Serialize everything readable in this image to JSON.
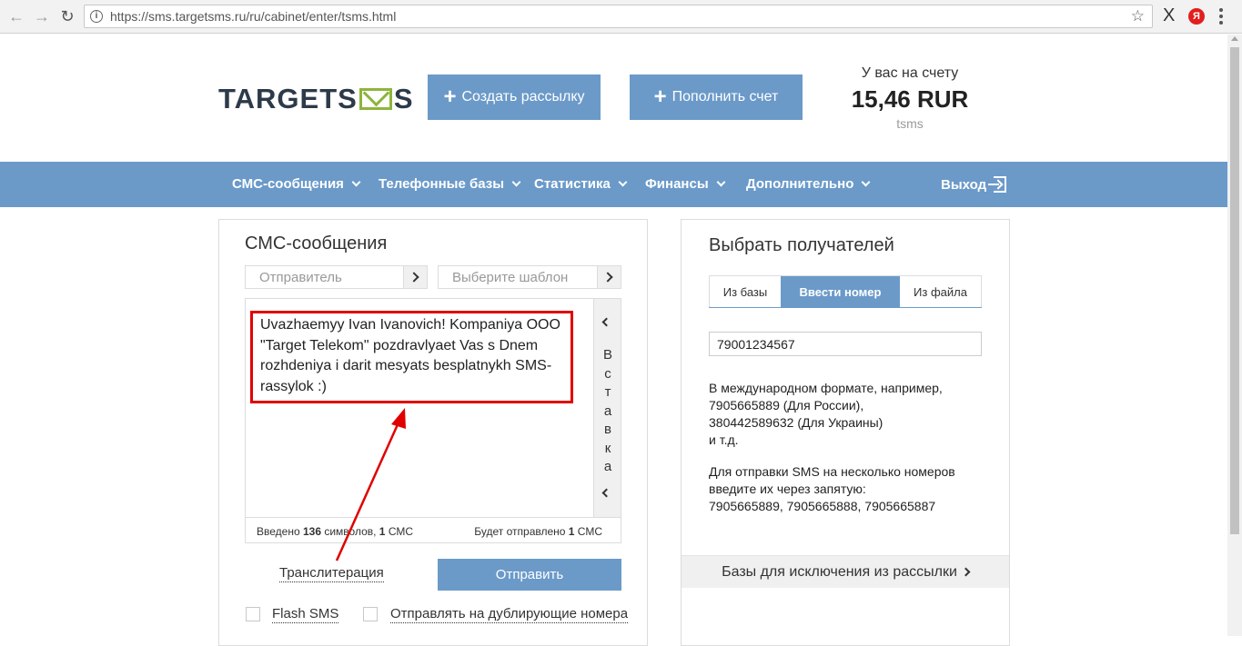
{
  "browser": {
    "url": "https://sms.targetsms.ru/ru/cabinet/enter/tsms.html",
    "extension_x": "X",
    "extension_ya": "Я"
  },
  "header": {
    "logo_left": "TARGETS",
    "logo_right": "S",
    "create_button": "Создать рассылку",
    "topup_button": "Пополнить счет",
    "balance_label": "У вас на счету",
    "balance_value": "15,46 RUR",
    "login": "tsms"
  },
  "nav": {
    "items": [
      "СМС-сообщения",
      "Телефонные базы",
      "Статистика",
      "Финансы",
      "Дополнительно"
    ],
    "logout": "Выход",
    "accent": "#6b9ac9"
  },
  "sms_panel": {
    "title": "СМС-сообщения",
    "sender_placeholder": "Отправитель",
    "template_placeholder": "Выберите шаблон",
    "message": "Uvazhaemyy Ivan Ivanovich! Kompaniya OOO \"Target Telekom\" pozdravlyaet Vas s Dnem rozhdeniya i darit mesyats besplatnykh SMS-rassylok :)",
    "insert_label": [
      "В",
      "с",
      "т",
      "а",
      "в",
      "к",
      "а"
    ],
    "counter": {
      "prefix": "Введено ",
      "chars": "136",
      "middle": " символов, ",
      "sms": "1",
      "suffix": " СМС"
    },
    "will_send": {
      "prefix": "Будет отправлено ",
      "count": "1",
      "suffix": " СМС"
    },
    "transliteration": "Транслитерация",
    "send_button": "Отправить",
    "flash_sms": "Flash SMS",
    "send_duplicates": "Отправлять на дублирующие номера",
    "highlight_color": "#e00000"
  },
  "recipients_panel": {
    "title": "Выбрать получателей",
    "tabs": [
      "Из базы",
      "Ввести номер",
      "Из файла"
    ],
    "active_tab": "Ввести номер",
    "phone_value": "79001234567",
    "help1": [
      "В международном формате, например,",
      "7905665889 (Для России),",
      "380442589632 (Для Украины)",
      "и т.д."
    ],
    "help2": [
      "Для отправки SMS на несколько номеров",
      "введите их через запятую:",
      "7905665889, 7905665888, 7905665887"
    ],
    "exclusion_link": "Базы для исключения из рассылки"
  }
}
